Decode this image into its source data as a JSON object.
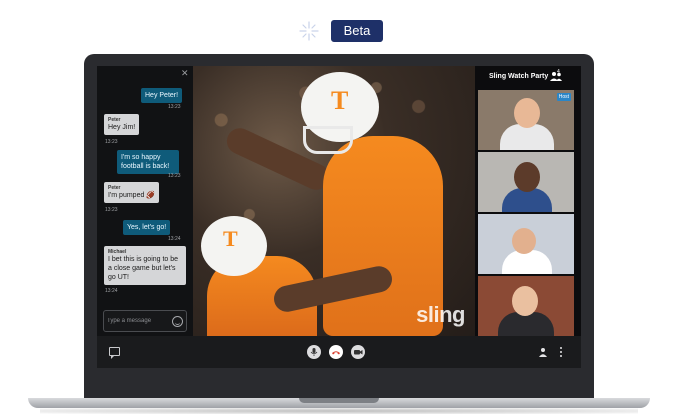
{
  "header": {
    "badge_label": "Beta"
  },
  "chat": {
    "messages": [
      {
        "direction": "out",
        "sender": "",
        "text": "Hey Peter!",
        "time": "13:23"
      },
      {
        "direction": "in",
        "sender": "Peter",
        "text": "Hey Jim!",
        "time": "13:23"
      },
      {
        "direction": "out",
        "sender": "",
        "text": "I'm so happy football is back!",
        "time": "13:23"
      },
      {
        "direction": "in",
        "sender": "Peter",
        "text": "I'm pumped 🏈",
        "time": "13:23"
      },
      {
        "direction": "out",
        "sender": "",
        "text": "Yes, let's go!",
        "time": "13:24"
      },
      {
        "direction": "in",
        "sender": "Michael",
        "text": "I bet this is going to be a close game but let's go UT!",
        "time": "13:24"
      }
    ],
    "input_placeholder": "Type a message",
    "close_icon": "close-icon",
    "emoji_icon": "smiley-icon"
  },
  "video": {
    "watermark": "sling"
  },
  "party": {
    "title": "Sling Watch Party",
    "participant_count": "4",
    "host_label": "Host",
    "tiles": [
      {
        "bg": "#8a7a6a",
        "skin": "#e8b896",
        "shirt": "#e9e9ea"
      },
      {
        "bg": "#b9b7b3",
        "skin": "#5c3b2a",
        "shirt": "#2e4f8c"
      },
      {
        "bg": "#c9cfd8",
        "skin": "#e2b08e",
        "shirt": "#ffffff"
      },
      {
        "bg": "#8b4a35",
        "skin": "#eac0a0",
        "shirt": "#2a2a2e"
      }
    ]
  },
  "controls": {
    "chat_icon": "chat-bubble-icon",
    "mic_icon": "microphone-icon",
    "hangup_icon": "hang-up-icon",
    "camera_icon": "video-camera-icon",
    "invite_icon": "add-person-icon",
    "more_icon": "more-vertical-icon"
  },
  "colors": {
    "brand_navy": "#1e3068",
    "chat_out_bubble": "#0f5b7a",
    "hangup_red": "#d83b2b",
    "host_badge": "#2b86c7"
  }
}
